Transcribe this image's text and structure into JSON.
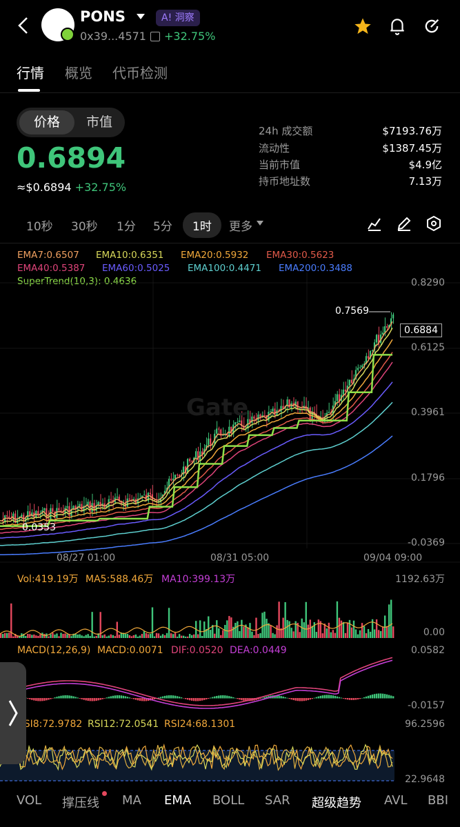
{
  "header": {
    "token_name": "PONS",
    "ai_badge": "A! 洞察",
    "address": "0x39...4571",
    "change": "+32.75%"
  },
  "tabs": [
    "行情",
    "概览",
    "代币检测"
  ],
  "toggle": {
    "price": "价格",
    "mcap": "市值"
  },
  "price": {
    "main": "0.6894",
    "usd": "≈$0.6894",
    "change": "+32.75%"
  },
  "stats": [
    {
      "label": "24h 成交额",
      "value": "$7193.76万"
    },
    {
      "label": "流动性",
      "value": "$1387.45万"
    },
    {
      "label": "当前市值",
      "value": "$4.9亿"
    },
    {
      "label": "持币地址数",
      "value": "7.13万"
    }
  ],
  "intervals": [
    "10秒",
    "30秒",
    "1分",
    "5分",
    "1时",
    "更多"
  ],
  "selected_interval": "1时",
  "ema_labels": [
    {
      "text": "EMA7:0.6507",
      "color": "#f0a060"
    },
    {
      "text": "EMA10:0.6351",
      "color": "#d8d85a"
    },
    {
      "text": "EMA20:0.5932",
      "color": "#f2a93b"
    },
    {
      "text": "EMA30:0.5623",
      "color": "#e25a4a"
    },
    {
      "text": "EMA40:0.5387",
      "color": "#e0447a"
    },
    {
      "text": "EMA60:0.5025",
      "color": "#6a5cff"
    },
    {
      "text": "EMA100:0.4471",
      "color": "#5ed0d0"
    },
    {
      "text": "EMA200:0.3488",
      "color": "#4a7dff"
    },
    {
      "text": "SuperTrend(10,3): 0.4636",
      "color": "#8fe04a"
    }
  ],
  "price_axis": [
    "0.8290",
    "0.6125",
    "0.3961",
    "0.1796",
    "-0.0369"
  ],
  "high_marker": "0.7569",
  "current_marker": "0.6884",
  "low_marker": "0.0353",
  "time_axis": [
    "08/27 01:00",
    "08/31 05:00",
    "09/04 09:00"
  ],
  "volume": {
    "labels": [
      {
        "text": "Vol:419.19万",
        "color": "#f2a93b"
      },
      {
        "text": "MA5:588.46万",
        "color": "#f2a93b"
      },
      {
        "text": "MA10:399.13万",
        "color": "#c43fd6"
      }
    ],
    "axis": [
      "1192.63万",
      "0.00"
    ]
  },
  "macd": {
    "labels": [
      {
        "text": "MACD(12,26,9)",
        "color": "#f2a93b"
      },
      {
        "text": "MACD:0.0071",
        "color": "#f2a93b"
      },
      {
        "text": "DIF:0.0520",
        "color": "#e0447a"
      },
      {
        "text": "DEA:0.0449",
        "color": "#c43fd6"
      }
    ],
    "axis": [
      "0.0582",
      "-0.0157"
    ]
  },
  "rsi": {
    "labels": [
      {
        "text": "RSI8:72.9782",
        "color": "#f2a93b"
      },
      {
        "text": "RSI12:72.0541",
        "color": "#d8d85a"
      },
      {
        "text": "RSI24:68.1301",
        "color": "#f2a93b"
      }
    ],
    "axis": [
      "96.2596",
      "22.9648"
    ]
  },
  "bottom_tabs": [
    "VOL",
    "撑压线",
    "MA",
    "EMA",
    "BOLL",
    "SAR",
    "超级趋势",
    "AVL",
    "BBI"
  ],
  "colors": {
    "up": "#3fc57a",
    "down": "#e5485d"
  }
}
